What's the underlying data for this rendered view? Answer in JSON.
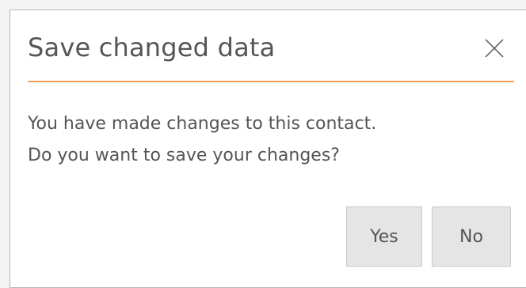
{
  "dialog": {
    "title": "Save changed data",
    "message_line1": "You have made changes to this contact.",
    "message_line2": "Do you want to save your changes?",
    "close_icon": "close-icon",
    "yes_label": "Yes",
    "no_label": "No",
    "accent_color": "#f0a058"
  }
}
